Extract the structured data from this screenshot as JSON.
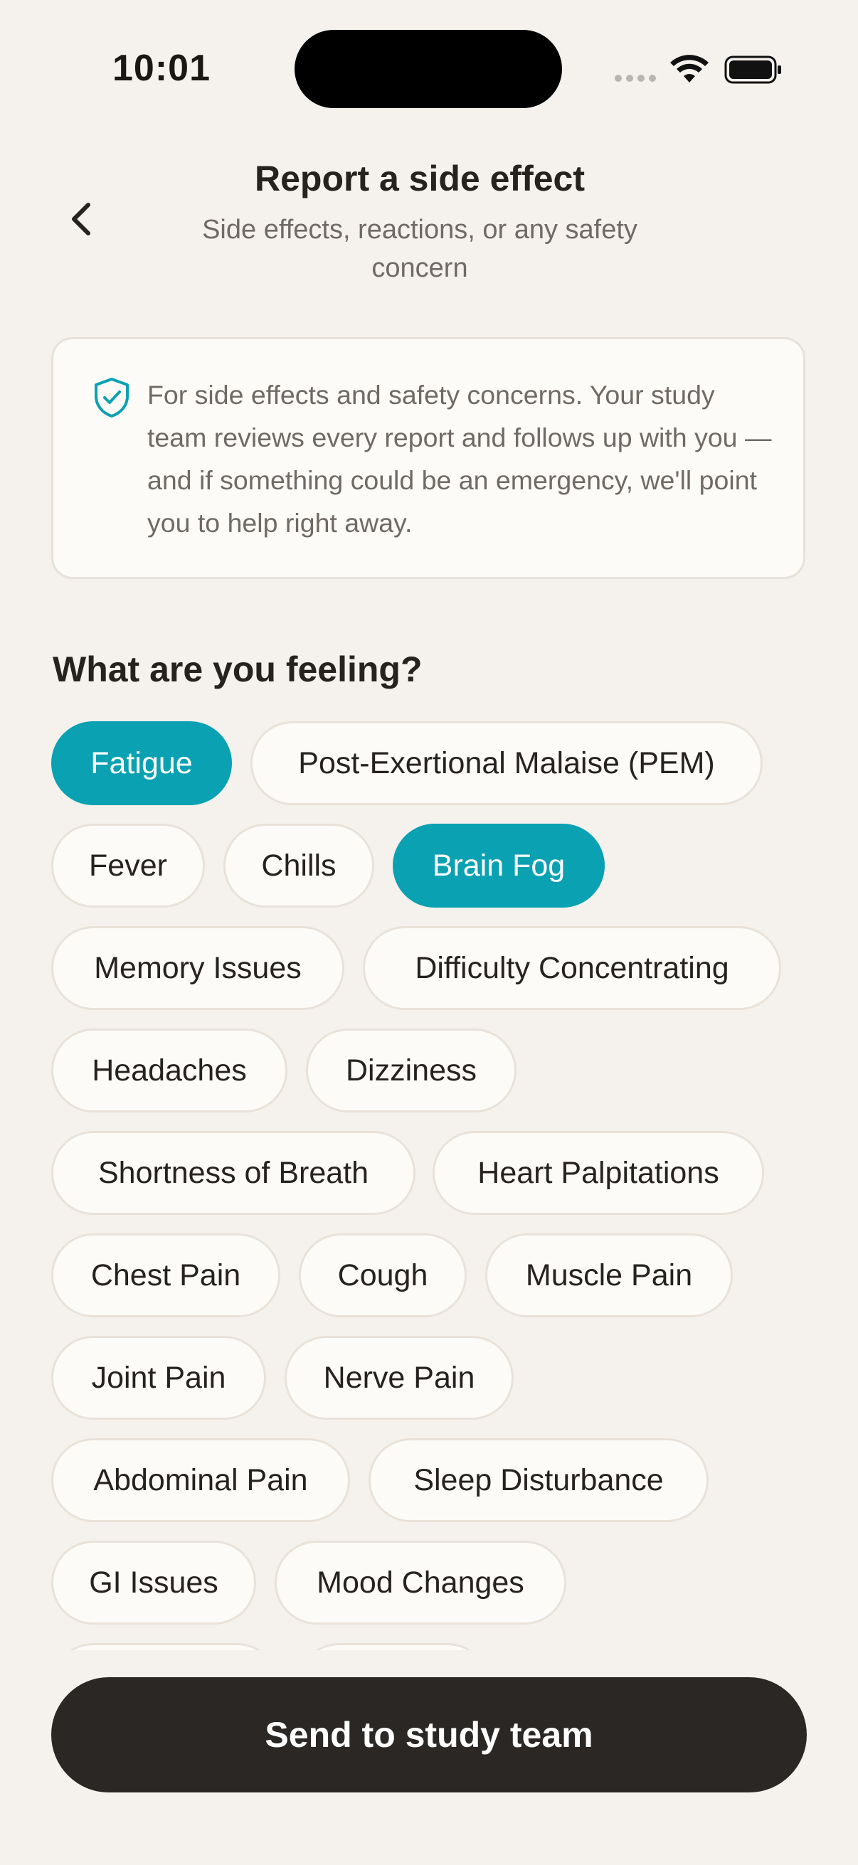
{
  "status_bar": {
    "time": "10:01"
  },
  "header": {
    "title": "Report a side effect",
    "subtitle": "Side effects, reactions, or any safety concern"
  },
  "info": {
    "icon": "shield-check-icon",
    "text": "For side effects and safety concerns. Your study team reviews every report and follows up with you — and if something could be an emergency, we'll point you to help right away."
  },
  "section": {
    "title": "What are you feeling?"
  },
  "symptoms": [
    {
      "label": "Fatigue",
      "selected": true
    },
    {
      "label": "Post-Exertional Malaise (PEM)",
      "selected": false
    },
    {
      "label": "Fever",
      "selected": false
    },
    {
      "label": "Chills",
      "selected": false
    },
    {
      "label": "Brain Fog",
      "selected": true
    },
    {
      "label": "Memory Issues",
      "selected": false
    },
    {
      "label": "Difficulty Concentrating",
      "selected": false
    },
    {
      "label": "Headaches",
      "selected": false
    },
    {
      "label": "Dizziness",
      "selected": false
    },
    {
      "label": "Shortness of Breath",
      "selected": false
    },
    {
      "label": "Heart Palpitations",
      "selected": false
    },
    {
      "label": "Chest Pain",
      "selected": false
    },
    {
      "label": "Cough",
      "selected": false
    },
    {
      "label": "Muscle Pain",
      "selected": false
    },
    {
      "label": "Joint Pain",
      "selected": false
    },
    {
      "label": "Nerve Pain",
      "selected": false
    },
    {
      "label": "Abdominal Pain",
      "selected": false
    },
    {
      "label": "Sleep Disturbance",
      "selected": false
    },
    {
      "label": "GI Issues",
      "selected": false
    },
    {
      "label": "Mood Changes",
      "selected": false
    }
  ],
  "colors": {
    "accent": "#0aa1b2",
    "background": "#f5f1ec",
    "button": "#2b2725"
  },
  "footer": {
    "send_label": "Send to study team"
  }
}
